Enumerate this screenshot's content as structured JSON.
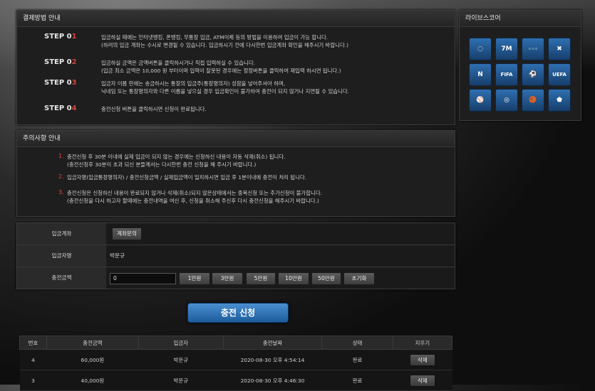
{
  "payment_info": {
    "title": "결제방법 안내",
    "steps": [
      {
        "label": "STEP 0",
        "num": "1",
        "lines": [
          "입금하실 때에는 인터넷뱅킹, 폰뱅킹, 무통장 입금, ATM이체 등의 방법을 이용하여 입금이 가능 합니다.",
          "(하려의 입금 계좌는 수시로 변경될 수 있습니다. 입금하시기 전에 다시한번 입금계좌 확인을 해주시기 바랍니다.)"
        ]
      },
      {
        "label": "STEP 0",
        "num": "2",
        "lines": [
          "입금하실 금액은 금액버튼을 클릭하시거나 직접 입력하실 수 있습니다.",
          "(입금 최소 금액은 10,000 원 부터이며 입력이 잘못된 경우에는 정정버튼을 클릭하여 재입력 하시면 됩니다.)"
        ]
      },
      {
        "label": "STEP 0",
        "num": "3",
        "lines": [
          "입금자 이름 란에는 송금하시는 통장의 입금주(통장명의자) 성함을 넣어주셔야 하며,",
          "닉네임 또는 통장명의자와 다른 이름을 넣으실 경우 입금확인이 불가하여 충전이 되지 않거나 지연될 수 있습니다."
        ]
      },
      {
        "label": "STEP 0",
        "num": "4",
        "lines": [
          "충전신청 버튼을 클릭하시면 신청이 완료됩니다."
        ]
      }
    ]
  },
  "notice": {
    "title": "주의사항 안내",
    "items": [
      {
        "num": "1.",
        "lines": [
          "충전신청 후 30분 이내에 실제 입금이 되지 않는 경우에는 신청하신 내용이 자동 삭제(취소) 됩니다.",
          "(충전신청후 30분이 초과 되신 분들께서는 다시한번 충전 신청을 해 주시기 바랍니다.)"
        ]
      },
      {
        "num": "2.",
        "lines": [
          "입금자명(입금통장명의자) / 충전신청금액 / 실제입금액이 일치하시면 입금 후 1분이내에 충전이 처리 됩니다."
        ]
      },
      {
        "num": "3.",
        "lines": [
          "충전신청은 신청하신 내용이 완료되지 않거나 삭제(취소)되지 않은상태에서는 중복신청 또는 추가신청이 불가합니다.",
          "(충전신청을 다시 하고자 할때에는 충전내역을 여신 후, 신청을 취소해 주신후 다시 충전신청을 해주시기 바랍니다.)"
        ]
      }
    ]
  },
  "form": {
    "account_label": "입금계좌",
    "account_button": "계좌문의",
    "depositor_label": "입금자명",
    "depositor_value": "박문규",
    "amount_label": "충전금액",
    "amount_value": "0",
    "amount_buttons": [
      "1만원",
      "3만원",
      "5만원",
      "10만원",
      "50만원",
      "초기화"
    ],
    "submit_label": "충전 신청"
  },
  "history": {
    "headers": [
      "번호",
      "충전금액",
      "입금자",
      "충전날짜",
      "상태",
      "지우기"
    ],
    "rows": [
      {
        "no": "4",
        "amount": "60,000원",
        "name": "박문규",
        "date": "2020-08-30 오후 4:54:14",
        "status": "완료",
        "action": "삭제"
      },
      {
        "no": "3",
        "amount": "40,000원",
        "name": "박문규",
        "date": "2020-08-30 오후 4:46:30",
        "status": "완료",
        "action": "삭제"
      }
    ]
  },
  "live_score": {
    "title": "라이브스코어",
    "icons": [
      {
        "name": "refresh-icon",
        "glyph": "◌",
        "color": "#2f6fb0"
      },
      {
        "name": "7m-icon",
        "glyph": "7M",
        "color": "#2f6fb0"
      },
      {
        "name": "livescore-icon",
        "glyph": "◦◦◦",
        "color": "#2f6fb0"
      },
      {
        "name": "cross-icon",
        "glyph": "✖",
        "color": "#2f6fb0"
      },
      {
        "name": "naver-icon",
        "glyph": "N",
        "color": "#2f6fb0"
      },
      {
        "name": "fifa-icon",
        "glyph": "FIFA",
        "color": "#2f6fb0"
      },
      {
        "name": "soccer-ball-icon",
        "glyph": "⚽",
        "color": "#2f6fb0"
      },
      {
        "name": "uefa-icon",
        "glyph": "UEFA",
        "color": "#2f6fb0"
      },
      {
        "name": "mlb-icon",
        "glyph": "⚾",
        "color": "#2f6fb0"
      },
      {
        "name": "kbo-icon",
        "glyph": "◎",
        "color": "#2f6fb0"
      },
      {
        "name": "nba-icon",
        "glyph": "🏀",
        "color": "#2f6fb0"
      },
      {
        "name": "nhl-icon",
        "glyph": "⬟",
        "color": "#2f6fb0"
      }
    ]
  }
}
